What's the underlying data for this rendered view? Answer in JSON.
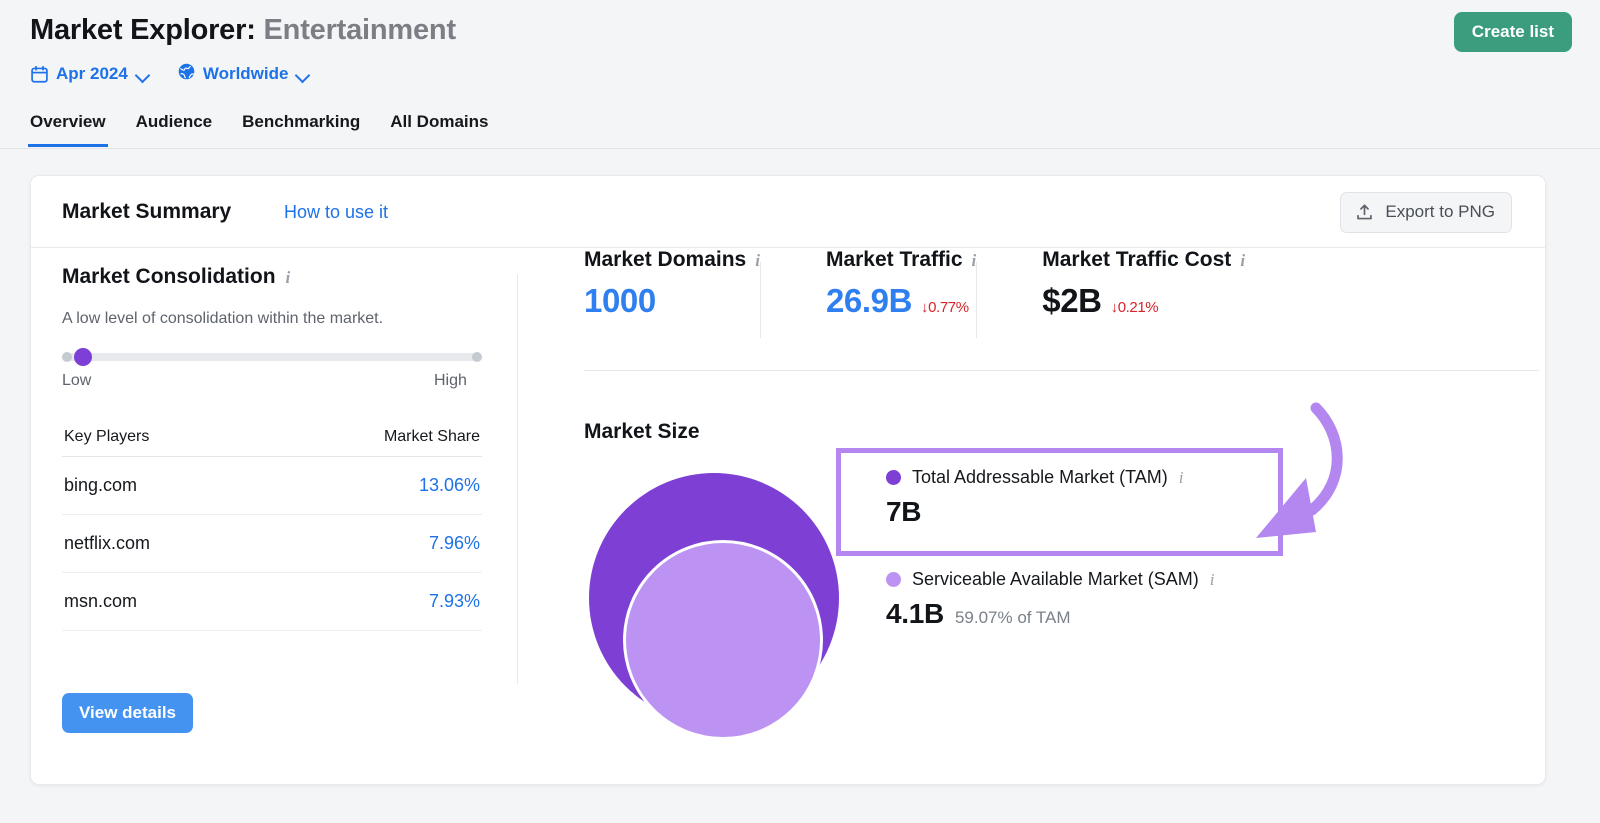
{
  "header": {
    "title_main": "Market Explorer:",
    "title_sub": "Entertainment",
    "create_list_label": "Create list",
    "filters": [
      {
        "icon": "calendar-icon",
        "label": "Apr 2024"
      },
      {
        "icon": "globe-icon",
        "label": "Worldwide"
      }
    ],
    "tabs": [
      {
        "label": "Overview",
        "active": true
      },
      {
        "label": "Audience",
        "active": false
      },
      {
        "label": "Benchmarking",
        "active": false
      },
      {
        "label": "All Domains",
        "active": false
      }
    ]
  },
  "card": {
    "title": "Market Summary",
    "how_to_use": "How to use it",
    "export_label": "Export to PNG"
  },
  "consolidation": {
    "title": "Market Consolidation",
    "description": "A low level of consolidation within the market.",
    "slider": {
      "value_pct": 4,
      "low_label": "Low",
      "high_label": "High"
    },
    "table": {
      "columns": [
        "Key Players",
        "Market Share"
      ],
      "rows": [
        {
          "player": "bing.com",
          "share": "13.06%"
        },
        {
          "player": "netflix.com",
          "share": "7.96%"
        },
        {
          "player": "msn.com",
          "share": "7.93%"
        }
      ]
    },
    "view_details_label": "View details"
  },
  "kpis": [
    {
      "label": "Market Domains",
      "value": "1000",
      "delta": "",
      "style": "blue"
    },
    {
      "label": "Market Traffic",
      "value": "26.9B",
      "delta": "↓0.77%",
      "style": "blue"
    },
    {
      "label": "Market Traffic Cost",
      "value": "$2B",
      "delta": "↓0.21%",
      "style": "dark"
    }
  ],
  "market_size": {
    "title": "Market Size",
    "tam": {
      "name": "Total Addressable Market (TAM)",
      "value": "7B",
      "color": "#7e3fd4",
      "highlighted": true
    },
    "sam": {
      "name": "Serviceable Available Market (SAM)",
      "value": "4.1B",
      "sub": "59.07% of TAM",
      "color": "#bc93f2"
    }
  },
  "annotation": {
    "type": "curved-arrow",
    "color": "#b386f0",
    "points_to": "tam-highlight-box"
  },
  "chart_data": {
    "type": "bubble",
    "title": "Market Size",
    "categories": [
      "Total Addressable Market (TAM)",
      "Serviceable Available Market (SAM)"
    ],
    "values": [
      7.0,
      4.1
    ],
    "value_labels": [
      "7B",
      "4.1B"
    ],
    "units": "billions of visits",
    "ratio_label": "59.07% of TAM",
    "colors": [
      "#7e3fd4",
      "#bc93f2"
    ],
    "legend": "right",
    "grid": false
  }
}
